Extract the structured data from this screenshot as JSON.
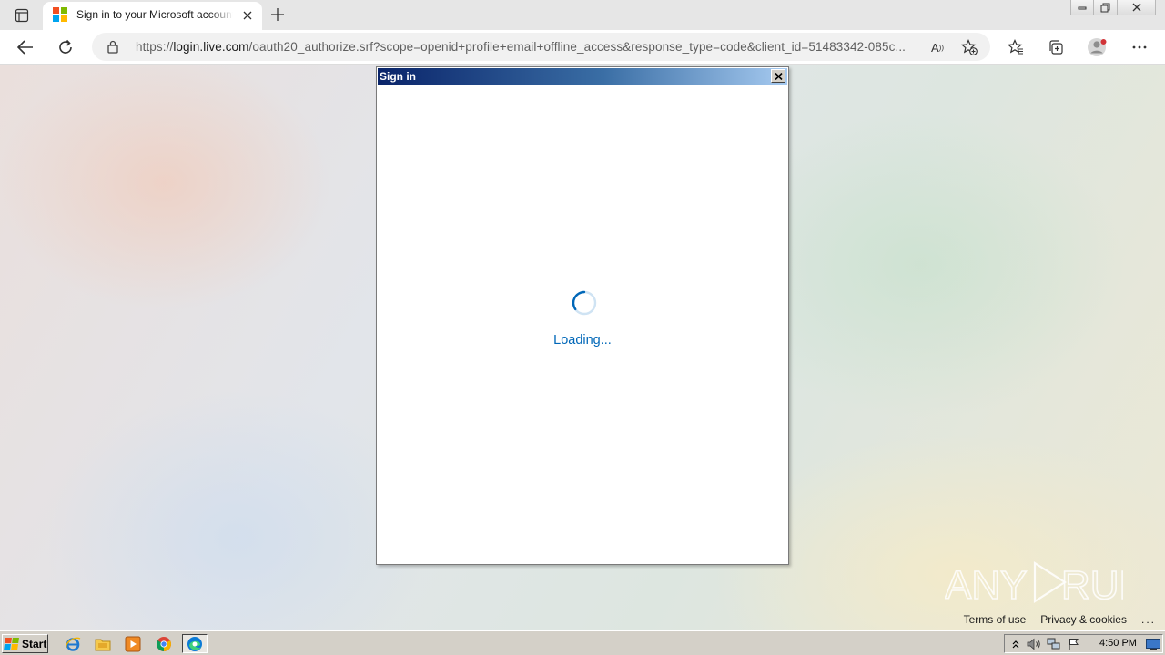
{
  "browser": {
    "tab": {
      "title": "Sign in to your Microsoft account",
      "favicon": "microsoft-logo-icon"
    },
    "address_bar": {
      "url_prefix": "https://",
      "url_host": "login.live.com",
      "url_rest": "/oauth20_authorize.srf?scope=openid+profile+email+offline_access&response_type=code&client_id=51483342-085c..."
    },
    "read_aloud_label": "A",
    "icons": [
      "tab-actions-icon",
      "close-icon",
      "new-tab-icon",
      "back-icon",
      "refresh-icon",
      "lock-icon",
      "read-aloud-icon",
      "add-favorite-icon",
      "favorites-icon",
      "collections-icon",
      "profile-icon",
      "more-icon",
      "minimize-icon",
      "restore-icon"
    ]
  },
  "dialog": {
    "title": "Sign in",
    "loading_text": "Loading..."
  },
  "page": {
    "watermark": "ANY RUN",
    "footer": {
      "terms": "Terms of use",
      "privacy": "Privacy & cookies",
      "more": "..."
    }
  },
  "taskbar": {
    "start_label": "Start",
    "apps": [
      "internet-explorer-icon",
      "file-explorer-icon",
      "media-player-icon",
      "chrome-icon",
      "edge-icon"
    ],
    "clock": "4:50 PM"
  },
  "colors": {
    "accent": "#0067b8",
    "dialog_title_start": "#0a246a",
    "dialog_title_end": "#a6caf0",
    "ms_red": "#f25022",
    "ms_green": "#7fba00",
    "ms_blue": "#00a4ef",
    "ms_yellow": "#ffb900"
  }
}
